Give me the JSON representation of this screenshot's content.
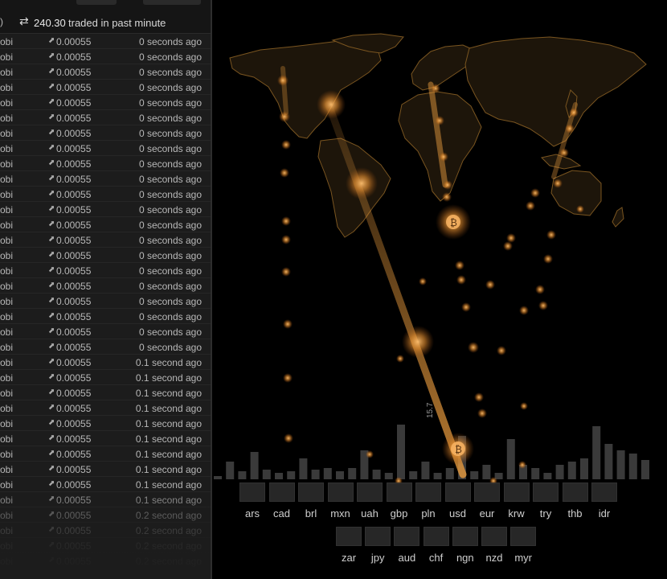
{
  "header": {
    "paren": ")",
    "swap_icon": "swap-icon",
    "amount": "240.30",
    "text": "traded in past minute"
  },
  "trades": [
    {
      "exchange": "obi",
      "amount": "0.00055",
      "ago": "0 seconds ago"
    },
    {
      "exchange": "obi",
      "amount": "0.00055",
      "ago": "0 seconds ago"
    },
    {
      "exchange": "obi",
      "amount": "0.00055",
      "ago": "0 seconds ago"
    },
    {
      "exchange": "obi",
      "amount": "0.00055",
      "ago": "0 seconds ago"
    },
    {
      "exchange": "obi",
      "amount": "0.00055",
      "ago": "0 seconds ago"
    },
    {
      "exchange": "obi",
      "amount": "0.00055",
      "ago": "0 seconds ago"
    },
    {
      "exchange": "obi",
      "amount": "0.00055",
      "ago": "0 seconds ago"
    },
    {
      "exchange": "obi",
      "amount": "0.00055",
      "ago": "0 seconds ago"
    },
    {
      "exchange": "obi",
      "amount": "0.00055",
      "ago": "0 seconds ago"
    },
    {
      "exchange": "obi",
      "amount": "0.00055",
      "ago": "0 seconds ago"
    },
    {
      "exchange": "obi",
      "amount": "0.00055",
      "ago": "0 seconds ago"
    },
    {
      "exchange": "obi",
      "amount": "0.00055",
      "ago": "0 seconds ago"
    },
    {
      "exchange": "obi",
      "amount": "0.00055",
      "ago": "0 seconds ago"
    },
    {
      "exchange": "obi",
      "amount": "0.00055",
      "ago": "0 seconds ago"
    },
    {
      "exchange": "obi",
      "amount": "0.00055",
      "ago": "0 seconds ago"
    },
    {
      "exchange": "obi",
      "amount": "0.00055",
      "ago": "0 seconds ago"
    },
    {
      "exchange": "obi",
      "amount": "0.00055",
      "ago": "0 seconds ago"
    },
    {
      "exchange": "obi",
      "amount": "0.00055",
      "ago": "0 seconds ago"
    },
    {
      "exchange": "obi",
      "amount": "0.00055",
      "ago": "0 seconds ago"
    },
    {
      "exchange": "obi",
      "amount": "0.00055",
      "ago": "0 seconds ago"
    },
    {
      "exchange": "obi",
      "amount": "0.00055",
      "ago": "0 seconds ago"
    },
    {
      "exchange": "obi",
      "amount": "0.00055",
      "ago": "0.1 second ago"
    },
    {
      "exchange": "obi",
      "amount": "0.00055",
      "ago": "0.1 second ago"
    },
    {
      "exchange": "obi",
      "amount": "0.00055",
      "ago": "0.1 second ago"
    },
    {
      "exchange": "obi",
      "amount": "0.00055",
      "ago": "0.1 second ago"
    },
    {
      "exchange": "obi",
      "amount": "0.00055",
      "ago": "0.1 second ago"
    },
    {
      "exchange": "obi",
      "amount": "0.00055",
      "ago": "0.1 second ago"
    },
    {
      "exchange": "obi",
      "amount": "0.00055",
      "ago": "0.1 second ago"
    },
    {
      "exchange": "obi",
      "amount": "0.00055",
      "ago": "0.1 second ago"
    },
    {
      "exchange": "obi",
      "amount": "0.00055",
      "ago": "0.1 second ago"
    },
    {
      "exchange": "obi",
      "amount": "0.00055",
      "ago": "0.1 second ago"
    },
    {
      "exchange": "obi",
      "amount": "0.00055",
      "ago": "0.2 second ago"
    },
    {
      "exchange": "obi",
      "amount": "0.00055",
      "ago": "0.2 second ago"
    },
    {
      "exchange": "obi",
      "amount": "0.00055",
      "ago": "0.2 second ago"
    },
    {
      "exchange": "obi",
      "amount": "0.00055",
      "ago": "0.2 second ago"
    }
  ],
  "volume_label": "15.7",
  "currencies": [
    "ars",
    "cad",
    "brl",
    "mxn",
    "uah",
    "gbp",
    "pln",
    "usd",
    "eur",
    "krw",
    "try",
    "thb",
    "idr",
    "zar",
    "jpy",
    "aud",
    "chf",
    "ngn",
    "nzd",
    "myr"
  ],
  "colors": {
    "accent": "#f0a040",
    "land": "#1d150a",
    "coast": "#7a5520",
    "panel": "#1c1c1c"
  },
  "icons": {
    "trade_arrow": "arrow-icon",
    "bitcoin": "bitcoin-icon"
  }
}
